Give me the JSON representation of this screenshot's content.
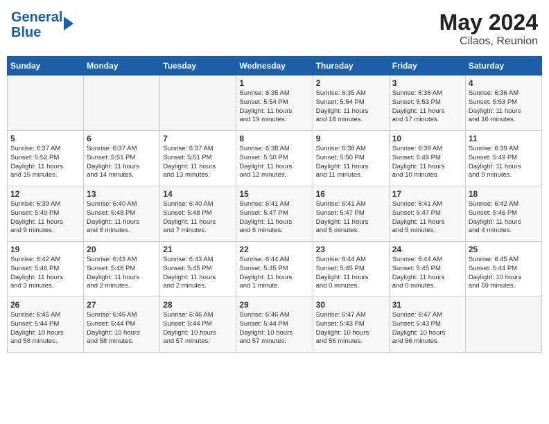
{
  "header": {
    "logo_line1": "General",
    "logo_line2": "Blue",
    "month_year": "May 2024",
    "location": "Cilaos, Reunion"
  },
  "days_of_week": [
    "Sunday",
    "Monday",
    "Tuesday",
    "Wednesday",
    "Thursday",
    "Friday",
    "Saturday"
  ],
  "weeks": [
    [
      {
        "day": "",
        "info": ""
      },
      {
        "day": "",
        "info": ""
      },
      {
        "day": "",
        "info": ""
      },
      {
        "day": "1",
        "info": "Sunrise: 6:35 AM\nSunset: 5:54 PM\nDaylight: 11 hours\nand 19 minutes."
      },
      {
        "day": "2",
        "info": "Sunrise: 6:35 AM\nSunset: 5:54 PM\nDaylight: 11 hours\nand 18 minutes."
      },
      {
        "day": "3",
        "info": "Sunrise: 6:36 AM\nSunset: 5:53 PM\nDaylight: 11 hours\nand 17 minutes."
      },
      {
        "day": "4",
        "info": "Sunrise: 6:36 AM\nSunset: 5:53 PM\nDaylight: 11 hours\nand 16 minutes."
      }
    ],
    [
      {
        "day": "5",
        "info": "Sunrise: 6:37 AM\nSunset: 5:52 PM\nDaylight: 11 hours\nand 15 minutes."
      },
      {
        "day": "6",
        "info": "Sunrise: 6:37 AM\nSunset: 5:51 PM\nDaylight: 11 hours\nand 14 minutes."
      },
      {
        "day": "7",
        "info": "Sunrise: 6:37 AM\nSunset: 5:51 PM\nDaylight: 11 hours\nand 13 minutes."
      },
      {
        "day": "8",
        "info": "Sunrise: 6:38 AM\nSunset: 5:50 PM\nDaylight: 11 hours\nand 12 minutes."
      },
      {
        "day": "9",
        "info": "Sunrise: 6:38 AM\nSunset: 5:50 PM\nDaylight: 11 hours\nand 11 minutes."
      },
      {
        "day": "10",
        "info": "Sunrise: 6:39 AM\nSunset: 5:49 PM\nDaylight: 11 hours\nand 10 minutes."
      },
      {
        "day": "11",
        "info": "Sunrise: 6:39 AM\nSunset: 5:49 PM\nDaylight: 11 hours\nand 9 minutes."
      }
    ],
    [
      {
        "day": "12",
        "info": "Sunrise: 6:39 AM\nSunset: 5:49 PM\nDaylight: 11 hours\nand 9 minutes."
      },
      {
        "day": "13",
        "info": "Sunrise: 6:40 AM\nSunset: 5:48 PM\nDaylight: 11 hours\nand 8 minutes."
      },
      {
        "day": "14",
        "info": "Sunrise: 6:40 AM\nSunset: 5:48 PM\nDaylight: 11 hours\nand 7 minutes."
      },
      {
        "day": "15",
        "info": "Sunrise: 6:41 AM\nSunset: 5:47 PM\nDaylight: 11 hours\nand 6 minutes."
      },
      {
        "day": "16",
        "info": "Sunrise: 6:41 AM\nSunset: 5:47 PM\nDaylight: 11 hours\nand 5 minutes."
      },
      {
        "day": "17",
        "info": "Sunrise: 6:41 AM\nSunset: 5:47 PM\nDaylight: 11 hours\nand 5 minutes."
      },
      {
        "day": "18",
        "info": "Sunrise: 6:42 AM\nSunset: 5:46 PM\nDaylight: 11 hours\nand 4 minutes."
      }
    ],
    [
      {
        "day": "19",
        "info": "Sunrise: 6:42 AM\nSunset: 5:46 PM\nDaylight: 11 hours\nand 3 minutes."
      },
      {
        "day": "20",
        "info": "Sunrise: 6:43 AM\nSunset: 5:46 PM\nDaylight: 11 hours\nand 2 minutes."
      },
      {
        "day": "21",
        "info": "Sunrise: 6:43 AM\nSunset: 5:45 PM\nDaylight: 11 hours\nand 2 minutes."
      },
      {
        "day": "22",
        "info": "Sunrise: 6:44 AM\nSunset: 5:45 PM\nDaylight: 11 hours\nand 1 minute."
      },
      {
        "day": "23",
        "info": "Sunrise: 6:44 AM\nSunset: 5:45 PM\nDaylight: 11 hours\nand 0 minutes."
      },
      {
        "day": "24",
        "info": "Sunrise: 6:44 AM\nSunset: 5:45 PM\nDaylight: 11 hours\nand 0 minutes."
      },
      {
        "day": "25",
        "info": "Sunrise: 6:45 AM\nSunset: 5:44 PM\nDaylight: 10 hours\nand 59 minutes."
      }
    ],
    [
      {
        "day": "26",
        "info": "Sunrise: 6:45 AM\nSunset: 5:44 PM\nDaylight: 10 hours\nand 58 minutes."
      },
      {
        "day": "27",
        "info": "Sunrise: 6:46 AM\nSunset: 5:44 PM\nDaylight: 10 hours\nand 58 minutes."
      },
      {
        "day": "28",
        "info": "Sunrise: 6:46 AM\nSunset: 5:44 PM\nDaylight: 10 hours\nand 57 minutes."
      },
      {
        "day": "29",
        "info": "Sunrise: 6:46 AM\nSunset: 5:44 PM\nDaylight: 10 hours\nand 57 minutes."
      },
      {
        "day": "30",
        "info": "Sunrise: 6:47 AM\nSunset: 5:43 PM\nDaylight: 10 hours\nand 56 minutes."
      },
      {
        "day": "31",
        "info": "Sunrise: 6:47 AM\nSunset: 5:43 PM\nDaylight: 10 hours\nand 56 minutes."
      },
      {
        "day": "",
        "info": ""
      }
    ]
  ]
}
